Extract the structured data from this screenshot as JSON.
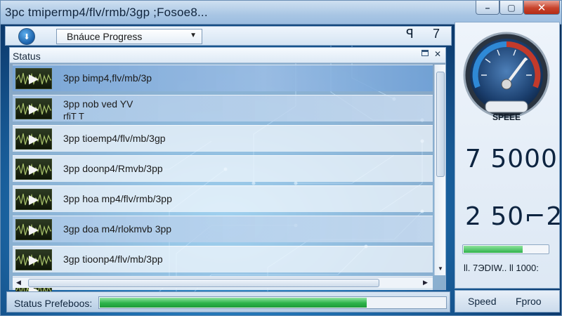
{
  "window": {
    "title": "3pc tmipermp4/flv/rmb/3gp ;Fosoe8...",
    "minimize": "–",
    "maximize": "▢",
    "close": "✕"
  },
  "toolbar": {
    "dropdown_value": "Bnáuce Progress",
    "right_glyph_1": "ꟼ",
    "right_glyph_2": "7"
  },
  "list": {
    "header": "Status",
    "rows": [
      {
        "title": "3pp bimp4,flv/mb/3p",
        "subtitle": "",
        "state": "selected"
      },
      {
        "title": "3pp nob ved YV",
        "subtitle": "rfiT T",
        "state": "highlight"
      },
      {
        "title": "3pp tioemp4/flv/mb/3gp",
        "subtitle": "",
        "state": "normal"
      },
      {
        "title": "3pp doonp4/Rmvb/3pp",
        "subtitle": "",
        "state": "normal"
      },
      {
        "title": "3pp hoa mp4/flv/rmb/3pp",
        "subtitle": "",
        "state": "normal"
      },
      {
        "title": "3gp doa m4/rlokmvb 3pp",
        "subtitle": "",
        "state": "highlight"
      },
      {
        "title": "3gp tioonp4/flv/mb/3pp",
        "subtitle": "",
        "state": "normal"
      },
      {
        "title": "",
        "subtitle": "",
        "state": "normal"
      }
    ]
  },
  "status": {
    "label": "Status Prefeboos:",
    "progress": 0.77
  },
  "side": {
    "gauge_label": "SPEEE",
    "value_1": "7 5000",
    "value_2": "2 50⌐2",
    "bar_progress": 0.7,
    "stats": "ll. 7ЭDIW.. ll 1000:"
  },
  "footer": {
    "speed": "Speed",
    "fproo": "Fproo"
  },
  "colors": {
    "accent": "#1f6fb0",
    "progress_green": "#2db34a",
    "close_red": "#c7422b"
  }
}
